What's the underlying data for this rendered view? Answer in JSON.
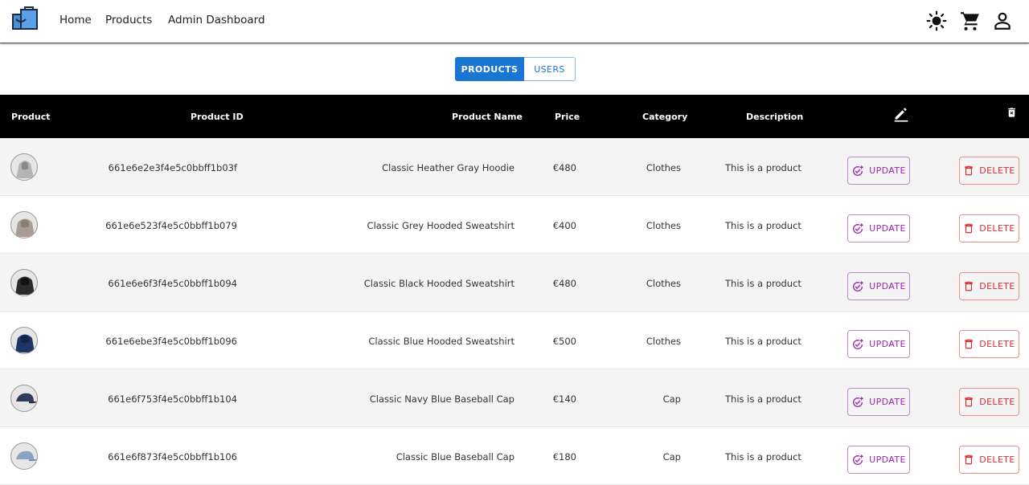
{
  "nav": {
    "links": [
      "Home",
      "Products",
      "Admin Dashboard"
    ],
    "icons": [
      "brightness-icon",
      "cart-icon",
      "account-icon"
    ]
  },
  "toggle": {
    "products": "PRODUCTS",
    "users": "USERS",
    "selected": "PRODUCTS"
  },
  "table": {
    "headers": {
      "product": "Product",
      "id": "Product ID",
      "name": "Product Name",
      "price": "Price",
      "category": "Category",
      "description": "Description"
    },
    "update_label": "UPDATE",
    "delete_label": "DELETE",
    "rows": [
      {
        "id": "661e6e2e3f4e5c0bbff1b03f",
        "name": "Classic Heather Gray Hoodie",
        "price": "€480",
        "category": "Clothes",
        "description": "This is a product",
        "image": "gray-hoodie"
      },
      {
        "id": "661e6e523f4e5c0bbff1b079",
        "name": "Classic Grey Hooded Sweatshirt",
        "price": "€400",
        "category": "Clothes",
        "description": "This is a product",
        "image": "grey-sweatshirt"
      },
      {
        "id": "661e6e6f3f4e5c0bbff1b094",
        "name": "Classic Black Hooded Sweatshirt",
        "price": "€480",
        "category": "Clothes",
        "description": "This is a product",
        "image": "black-sweatshirt"
      },
      {
        "id": "661e6ebe3f4e5c0bbff1b096",
        "name": "Classic Blue Hooded Sweatshirt",
        "price": "€500",
        "category": "Clothes",
        "description": "This is a product",
        "image": "blue-sweatshirt"
      },
      {
        "id": "661e6f753f4e5c0bbff1b104",
        "name": "Classic Navy Blue Baseball Cap",
        "price": "€140",
        "category": "Cap",
        "description": "This is a product",
        "image": "navy-cap"
      },
      {
        "id": "661e6f873f4e5c0bbff1b106",
        "name": "Classic Blue Baseball Cap",
        "price": "€180",
        "category": "Cap",
        "description": "This is a product",
        "image": "blue-cap"
      }
    ]
  },
  "colors": {
    "primary": "#1976d2",
    "update": "#9c27b0",
    "delete": "#d32f2f",
    "header_bg": "#000000"
  }
}
